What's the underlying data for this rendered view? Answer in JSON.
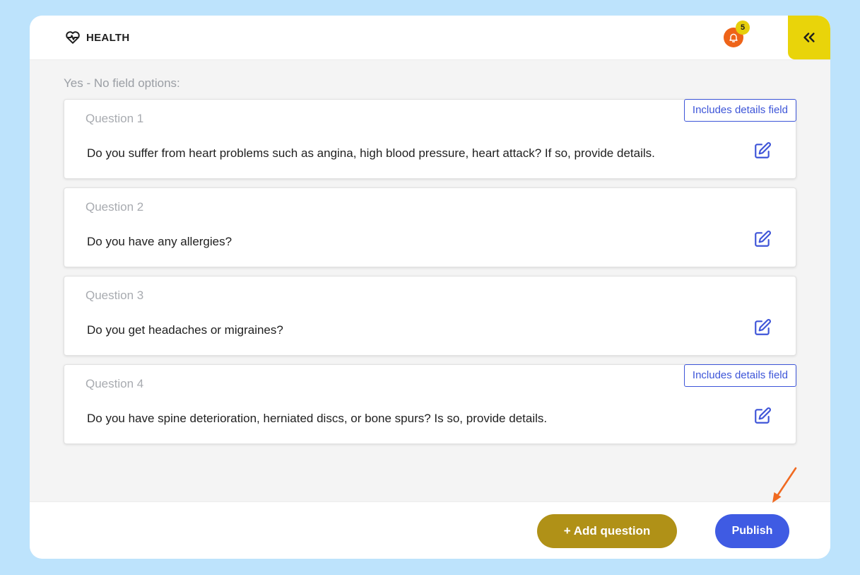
{
  "header": {
    "title": "HEALTH",
    "brand_icon": "heart-pulse-icon",
    "notifications_count": "5",
    "notification_icon": "bell-icon",
    "collapse_icon": "double-chevron-left-icon"
  },
  "section": {
    "title": "Yes - No field options:"
  },
  "questions": [
    {
      "label": "Question 1",
      "text": "Do you suffer from heart problems such as angina, high blood pressure, heart attack? If so, provide details.",
      "badge": "Includes details field"
    },
    {
      "label": "Question 2",
      "text": "Do you have any allergies?"
    },
    {
      "label": "Question 3",
      "text": "Do you get headaches or migraines?"
    },
    {
      "label": "Question 4",
      "text": "Do you have spine deterioration, herniated discs, or bone spurs? Is so, provide details.",
      "badge": "Includes details field"
    }
  ],
  "footer": {
    "add_label": "+ Add question",
    "publish_label": "Publish"
  },
  "colors": {
    "page_bg": "#bde3fc",
    "accent_yellow": "#e9d40a",
    "accent_blue": "#3f5be3",
    "add_button": "#b09117",
    "notification": "#ee6419",
    "annotation_arrow": "#f06a21"
  }
}
